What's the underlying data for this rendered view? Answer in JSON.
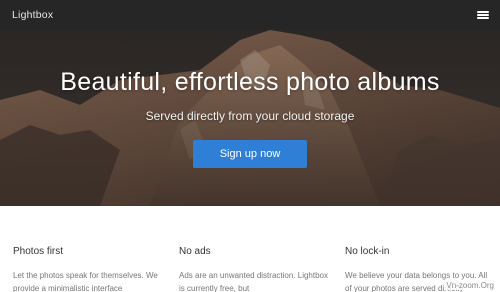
{
  "navbar": {
    "brand": "Lightbox",
    "menu_icon": "hamburger-menu-icon"
  },
  "hero": {
    "title": "Beautiful, effortless photo albums",
    "subtitle": "Served directly from your cloud storage",
    "cta_label": "Sign up now",
    "cta_color": "#2f7fd6"
  },
  "features": [
    {
      "title": "Photos first",
      "text": "Let the photos speak for themselves. We provide a minimalistic interface"
    },
    {
      "title": "No ads",
      "text": "Ads are an unwanted distraction. Lightbox is currently free, but"
    },
    {
      "title": "No lock-in",
      "text": "We believe your data belongs to you. All of your photos are served directly"
    }
  ],
  "watermark": "Vn-zoom.Org"
}
